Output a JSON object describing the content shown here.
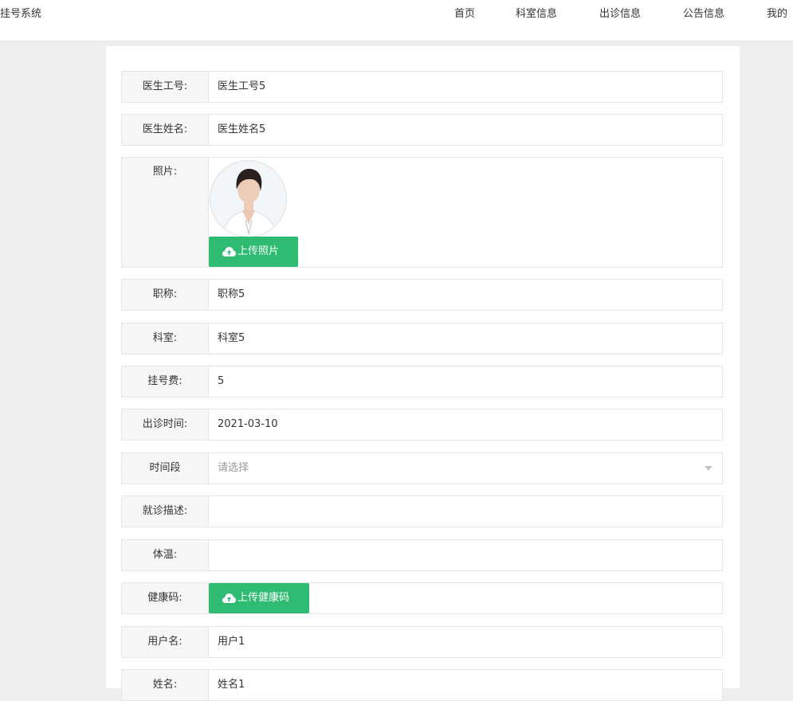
{
  "header": {
    "brand": "挂号系统",
    "nav": [
      "首页",
      "科室信息",
      "出诊信息",
      "公告信息",
      "我的"
    ]
  },
  "form": {
    "doctor_id": {
      "label": "医生工号:",
      "value": "医生工号5"
    },
    "doctor_name": {
      "label": "医生姓名:",
      "value": "医生姓名5"
    },
    "photo": {
      "label": "照片:",
      "upload_label": "上传照片"
    },
    "title": {
      "label": "职称:",
      "value": "职称5"
    },
    "department": {
      "label": "科室:",
      "value": "科室5"
    },
    "fee": {
      "label": "挂号费:",
      "value": "5"
    },
    "date": {
      "label": "出诊时间:",
      "value": "2021-03-10"
    },
    "period": {
      "label": "时间段",
      "placeholder": "请选择"
    },
    "description": {
      "label": "就诊描述:",
      "value": ""
    },
    "temperature": {
      "label": "体温:",
      "value": ""
    },
    "health_code": {
      "label": "健康码:",
      "upload_label": "上传健康码"
    },
    "username": {
      "label": "用户名:",
      "value": "用户1"
    },
    "realname": {
      "label": "姓名:",
      "value": "姓名1"
    }
  },
  "colors": {
    "primary_button": "#2fbb72",
    "label_bg": "#f6f6f6",
    "page_bg": "#efefef"
  },
  "icons": {
    "upload": "cloud-upload-icon",
    "select": "caret-down-icon"
  }
}
